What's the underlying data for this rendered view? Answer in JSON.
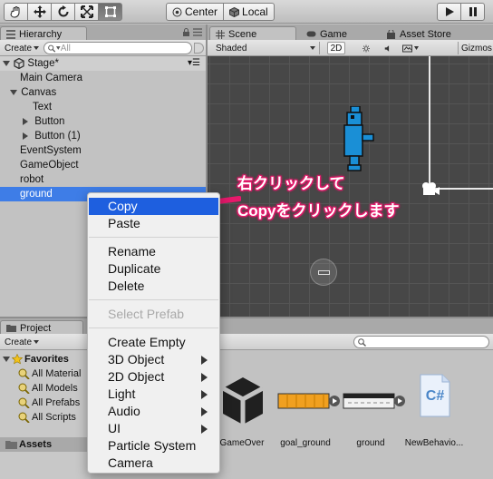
{
  "toolbar": {
    "tools": [
      "hand-tool-icon",
      "move-tool-icon",
      "rotate-tool-icon",
      "scale-tool-icon",
      "rect-tool-icon"
    ],
    "pivot_label": "Center",
    "handle_label": "Local"
  },
  "hierarchy": {
    "tab_label": "Hierarchy",
    "create_label": "Create",
    "search_placeholder": "All",
    "scene_name": "Stage*",
    "items": [
      {
        "label": "Main Camera"
      },
      {
        "label": "Canvas"
      },
      {
        "label": "Text"
      },
      {
        "label": "Button"
      },
      {
        "label": "Button (1)"
      },
      {
        "label": "EventSystem"
      },
      {
        "label": "GameObject"
      },
      {
        "label": "robot"
      },
      {
        "label": "ground"
      }
    ]
  },
  "scene": {
    "tabs": [
      {
        "label": "Scene"
      },
      {
        "label": "Game"
      },
      {
        "label": "Asset Store"
      }
    ],
    "shading_mode": "Shaded",
    "mode_2d": "2D",
    "gizmos_label": "Gizmos"
  },
  "project": {
    "tab_label": "Project",
    "create_label": "Create",
    "favorites_label": "Favorites",
    "favorites": [
      {
        "label": "All Material"
      },
      {
        "label": "All Models"
      },
      {
        "label": "All Prefabs"
      },
      {
        "label": "All Scripts"
      }
    ],
    "assets_label": "Assets",
    "assets": [
      {
        "label": "GameOver"
      },
      {
        "label": "goal_ground"
      },
      {
        "label": "ground"
      },
      {
        "label": "NewBehavio..."
      }
    ],
    "script_icon_text": "C#"
  },
  "context_menu": {
    "items": [
      {
        "label": "Copy"
      },
      {
        "label": "Paste"
      },
      {
        "label": "Rename"
      },
      {
        "label": "Duplicate"
      },
      {
        "label": "Delete"
      },
      {
        "label": "Select Prefab"
      },
      {
        "label": "Create Empty"
      },
      {
        "label": "3D Object"
      },
      {
        "label": "2D Object"
      },
      {
        "label": "Light"
      },
      {
        "label": "Audio"
      },
      {
        "label": "UI"
      },
      {
        "label": "Particle System"
      },
      {
        "label": "Camera"
      }
    ]
  },
  "annotation": {
    "line1": "右クリックして",
    "line2": "Copyをクリックします",
    "color": "#e6196b"
  },
  "colors": {
    "selection": "#3e7de7",
    "menu_highlight": "#1e5fdf",
    "robot": "#1a8fd6"
  }
}
